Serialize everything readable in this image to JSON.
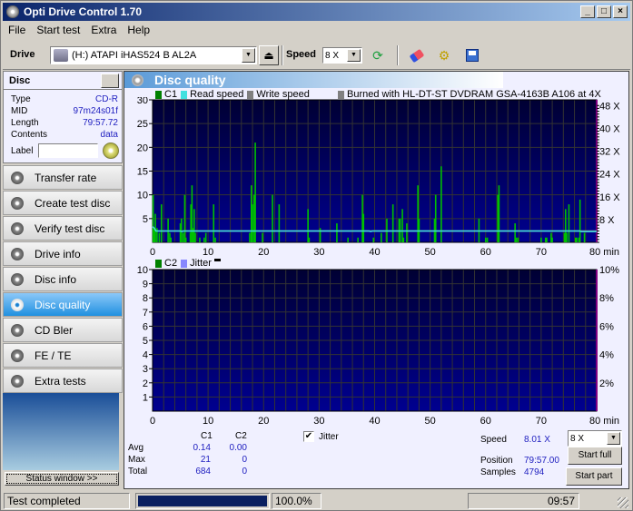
{
  "window": {
    "title": "Opti Drive Control 1.70"
  },
  "menu": [
    "File",
    "Start test",
    "Extra",
    "Help"
  ],
  "toolbar": {
    "drive_label": "Drive",
    "drive_value": "(H:)   ATAPI iHAS524   B AL2A",
    "speed_label": "Speed",
    "speed_value": "8 X"
  },
  "disc": {
    "header": "Disc",
    "rows": [
      {
        "label": "Type",
        "value": "CD-R"
      },
      {
        "label": "MID",
        "value": "97m24s01f"
      },
      {
        "label": "Length",
        "value": "79:57.72"
      },
      {
        "label": "Contents",
        "value": "data"
      }
    ],
    "label_field_label": "Label",
    "label_field_value": ""
  },
  "nav": [
    {
      "label": "Transfer rate",
      "active": false
    },
    {
      "label": "Create test disc",
      "active": false
    },
    {
      "label": "Verify test disc",
      "active": false
    },
    {
      "label": "Drive info",
      "active": false
    },
    {
      "label": "Disc info",
      "active": false
    },
    {
      "label": "Disc quality",
      "active": true
    },
    {
      "label": "CD Bler",
      "active": false
    },
    {
      "label": "FE / TE",
      "active": false
    },
    {
      "label": "Extra tests",
      "active": false
    }
  ],
  "status_window_button": "Status window >>",
  "panel": {
    "title": "Disc quality"
  },
  "legend1": {
    "c1": "C1",
    "read": "Read speed",
    "write": "Write speed",
    "burned": "Burned with HL-DT-ST DVDRAM GSA-4163B A106 at 4X"
  },
  "legend2": {
    "c2": "C2",
    "jitter": "Jitter"
  },
  "colors": {
    "c1": "#00c000",
    "read_speed": "#40e0e0",
    "write_speed": "#909090",
    "c2": "#008000",
    "jitter": "#8888ff",
    "plot_top": "#000033",
    "plot_bottom": "#000090"
  },
  "chart_data": [
    {
      "type": "bar",
      "title": "C1",
      "xlabel": "min",
      "xlim": [
        0,
        80
      ],
      "ylim_left": [
        0,
        30
      ],
      "ylim_right_label": "X",
      "x_ticks": [
        "0",
        "10",
        "20",
        "30",
        "40",
        "50",
        "60",
        "70",
        "80 min"
      ],
      "y_ticks_left": [
        "5",
        "10",
        "15",
        "20",
        "25",
        "30"
      ],
      "y_ticks_right": [
        "8 X",
        "16 X",
        "24 X",
        "32 X",
        "40 X",
        "48 X"
      ],
      "series": [
        {
          "name": "C1",
          "points": [
            [
              0.1,
              10
            ],
            [
              0.3,
              3
            ],
            [
              0.5,
              6
            ],
            [
              0.8,
              3
            ],
            [
              1.2,
              2
            ],
            [
              1.6,
              8
            ],
            [
              2.8,
              5
            ],
            [
              3.1,
              2
            ],
            [
              3.3,
              1
            ],
            [
              5.0,
              4
            ],
            [
              5.2,
              5
            ],
            [
              5.5,
              2
            ],
            [
              5.8,
              10
            ],
            [
              6.0,
              1
            ],
            [
              6.8,
              2
            ],
            [
              6.9,
              8
            ],
            [
              7.1,
              12
            ],
            [
              7.3,
              3
            ],
            [
              7.5,
              7
            ],
            [
              7.7,
              2
            ],
            [
              8.5,
              1
            ],
            [
              9.3,
              1
            ],
            [
              9.6,
              2
            ],
            [
              11.0,
              8
            ],
            [
              11.3,
              1
            ],
            [
              17.5,
              2
            ],
            [
              17.8,
              12
            ],
            [
              18.0,
              8
            ],
            [
              18.3,
              10
            ],
            [
              18.5,
              21
            ],
            [
              19.8,
              2
            ],
            [
              21.6,
              10
            ],
            [
              22.8,
              8
            ],
            [
              28.0,
              7
            ],
            [
              28.2,
              1
            ],
            [
              30.2,
              3
            ],
            [
              33.2,
              4
            ],
            [
              35.2,
              1
            ],
            [
              37.0,
              1
            ],
            [
              37.8,
              10
            ],
            [
              38.0,
              6
            ],
            [
              39.8,
              1
            ],
            [
              41.2,
              2
            ],
            [
              42.2,
              5
            ],
            [
              43.3,
              8
            ],
            [
              44.4,
              5
            ],
            [
              44.6,
              5
            ],
            [
              45.0,
              7
            ],
            [
              45.2,
              1
            ],
            [
              45.8,
              4
            ],
            [
              47.8,
              12
            ],
            [
              48.0,
              5
            ],
            [
              50.8,
              5
            ],
            [
              51.0,
              10
            ],
            [
              52.0,
              16
            ],
            [
              58.8,
              5
            ],
            [
              60.0,
              1
            ],
            [
              60.3,
              1
            ],
            [
              62.2,
              10
            ],
            [
              62.4,
              12
            ],
            [
              65.3,
              4
            ],
            [
              65.5,
              1
            ],
            [
              65.8,
              1
            ],
            [
              70.0,
              1
            ],
            [
              70.8,
              1
            ],
            [
              71.0,
              1
            ],
            [
              71.8,
              2
            ],
            [
              72.0,
              1
            ],
            [
              74.2,
              2
            ],
            [
              74.4,
              7
            ],
            [
              74.6,
              2
            ],
            [
              75.0,
              8
            ],
            [
              76.2,
              1
            ],
            [
              76.4,
              1
            ],
            [
              76.8,
              1
            ],
            [
              77.0,
              9
            ],
            [
              77.8,
              2
            ]
          ]
        },
        {
          "name": "Read speed",
          "unit": "X",
          "values_desc": "approx 8X across disc, slightly higher at start",
          "points": [
            [
              0,
              11
            ],
            [
              0.3,
              10
            ],
            [
              0.6,
              8
            ],
            [
              5,
              8
            ],
            [
              5.3,
              7.6
            ],
            [
              5.6,
              8
            ],
            [
              39,
              8
            ],
            [
              39.3,
              7.6
            ],
            [
              39.6,
              8
            ],
            [
              77,
              8
            ],
            [
              77.2,
              7.6
            ],
            [
              80,
              7.6
            ]
          ]
        },
        {
          "name": "Write speed",
          "unit": "X",
          "points": [
            [
              0,
              4
            ],
            [
              80,
              4
            ]
          ]
        }
      ]
    },
    {
      "type": "bar",
      "title": "C2 / Jitter",
      "xlabel": "min",
      "xlim": [
        0,
        80
      ],
      "ylim_left": [
        0,
        10
      ],
      "ylim_right": [
        0,
        10
      ],
      "x_ticks": [
        "0",
        "10",
        "20",
        "30",
        "40",
        "50",
        "60",
        "70",
        "80 min"
      ],
      "y_ticks_left": [
        "1",
        "2",
        "3",
        "4",
        "5",
        "6",
        "7",
        "8",
        "9",
        "10"
      ],
      "y_ticks_right": [
        "2%",
        "4%",
        "6%",
        "8%",
        "10%"
      ],
      "series": [
        {
          "name": "C2",
          "points": []
        },
        {
          "name": "Jitter",
          "points": []
        }
      ]
    }
  ],
  "stats": {
    "col_c1": "C1",
    "col_c2": "C2",
    "rows": [
      {
        "label": "Avg",
        "c1": "0.14",
        "c2": "0.00"
      },
      {
        "label": "Max",
        "c1": "21",
        "c2": "0"
      },
      {
        "label": "Total",
        "c1": "684",
        "c2": "0"
      }
    ]
  },
  "jitter_checkbox": {
    "label": "Jitter",
    "checked": true
  },
  "speed_info": {
    "speed_label": "Speed",
    "speed_value": "8.01 X",
    "position_label": "Position",
    "position_value": "79:57.00",
    "samples_label": "Samples",
    "samples_value": "4794",
    "speed_select": "8 X",
    "start_full": "Start full",
    "start_part": "Start part"
  },
  "statusbar": {
    "text": "Test completed",
    "progress": 1.0,
    "percent": "100.0%",
    "time": "09:57"
  }
}
